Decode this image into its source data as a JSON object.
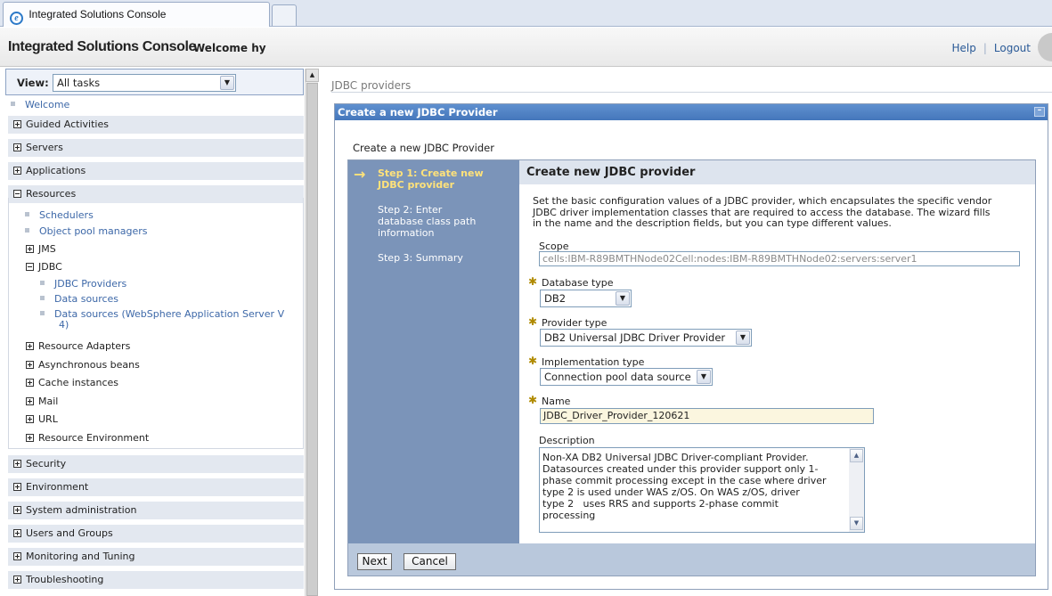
{
  "browser": {
    "tab_title": "Integrated Solutions Console"
  },
  "header": {
    "title": "Integrated Solutions Console",
    "welcome": "Welcome hy",
    "help": "Help",
    "logout": "Logout"
  },
  "nav": {
    "view_label": "View:",
    "view_value": "All tasks",
    "welcome": "Welcome",
    "categories": [
      "Guided Activities",
      "Servers",
      "Applications",
      "Resources",
      "Security",
      "Environment",
      "System administration",
      "Users and Groups",
      "Monitoring and Tuning",
      "Troubleshooting"
    ],
    "resources": {
      "schedulers": "Schedulers",
      "object_pool": "Object pool managers",
      "jms": "JMS",
      "jdbc": "JDBC",
      "jdbc_providers": "JDBC Providers",
      "data_sources": "Data sources",
      "data_sources_v4_line1": "Data sources (WebSphere Application Server V",
      "data_sources_v4_line2": "4)",
      "resource_adapters": "Resource Adapters",
      "async_beans": "Asynchronous beans",
      "cache_instances": "Cache instances",
      "mail": "Mail",
      "url": "URL",
      "resource_env": "Resource Environment"
    }
  },
  "content": {
    "breadcrumb": "JDBC providers",
    "panel_title": "Create a new JDBC Provider",
    "panel_subtitle": "Create a new JDBC Provider",
    "steps": {
      "step1_line1": "Step 1: Create new",
      "step1_line2": "JDBC provider",
      "step2_line1": "Step 2: Enter",
      "step2_line2": "database class path",
      "step2_line3": "information",
      "step3": "Step 3: Summary"
    },
    "form": {
      "heading": "Create new JDBC provider",
      "intro_line1": "Set the basic configuration values of a JDBC provider, which encapsulates the specific vendor",
      "intro_line2": "JDBC driver implementation classes that are required to access the database. The wizard fills",
      "intro_line3": "in the name and the description fields, but you can type different values.",
      "scope_label": "Scope",
      "scope_value": "cells:IBM-R89BMTHNode02Cell:nodes:IBM-R89BMTHNode02:servers:server1",
      "db_type_label": "Database type",
      "db_type_value": "DB2",
      "provider_type_label": "Provider type",
      "provider_type_value": "DB2 Universal JDBC Driver Provider",
      "impl_type_label": "Implementation type",
      "impl_type_value": "Connection pool data source",
      "name_label": "Name",
      "name_value": "JDBC_Driver_Provider_120621",
      "description_label": "Description",
      "description_lines": [
        "Non-XA DB2 Universal JDBC Driver-compliant Provider.",
        "Datasources created under this provider support only 1-",
        "phase commit processing except in the case where driver",
        "type 2 is used under WAS z/OS. On WAS z/OS, driver",
        "type 2   uses RRS and supports 2-phase commit",
        "processing"
      ]
    },
    "buttons": {
      "next": "Next",
      "cancel": "Cancel"
    }
  }
}
